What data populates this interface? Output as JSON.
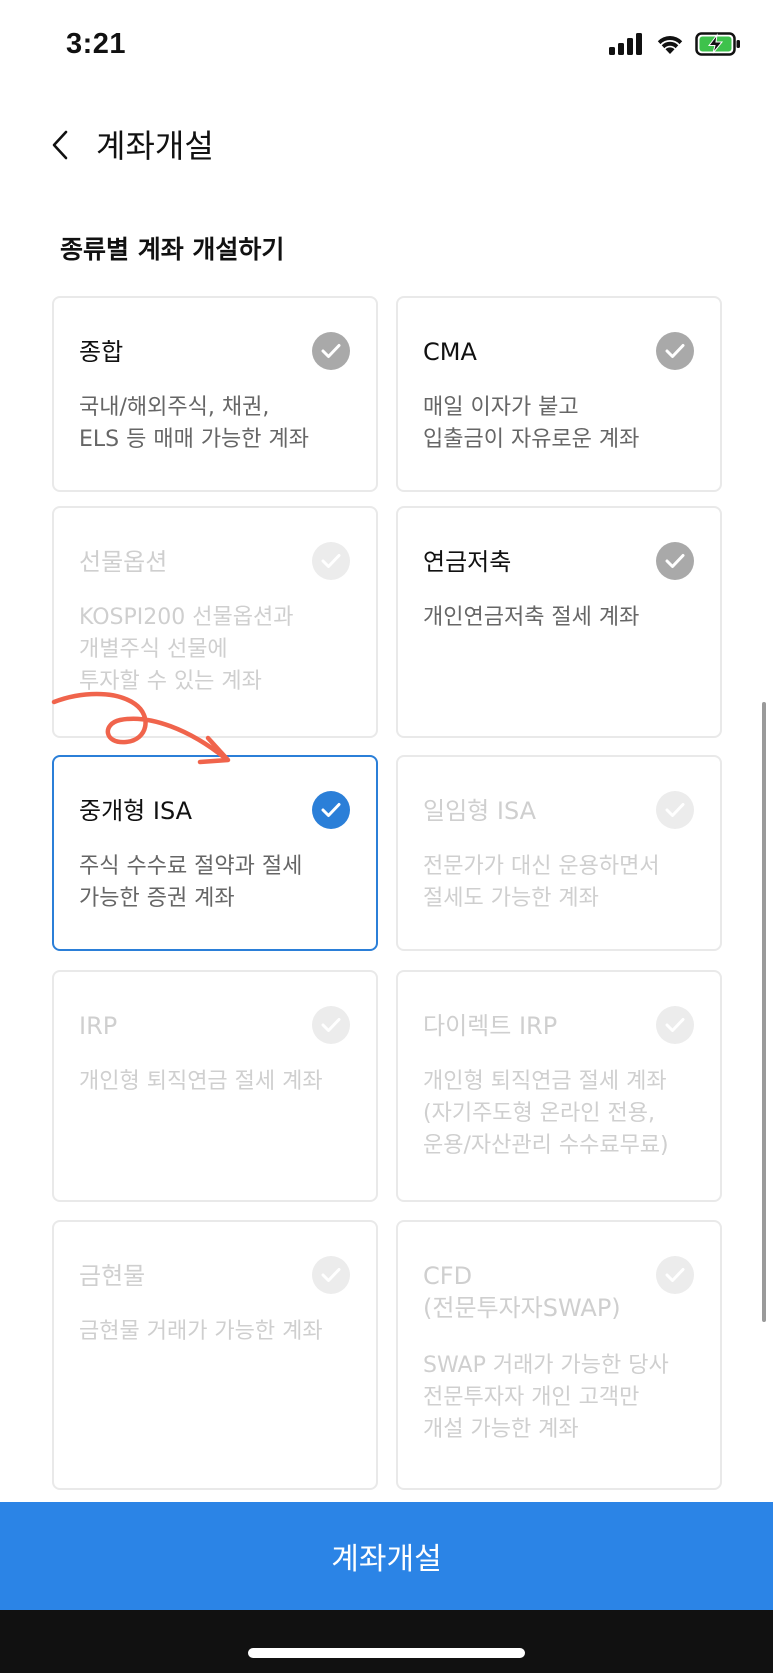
{
  "status_bar": {
    "time": "3:21",
    "icons": [
      "signal-icon",
      "wifi-icon",
      "battery-charging-icon"
    ]
  },
  "header": {
    "back_icon": "chevron-left-icon",
    "title": "계좌개설"
  },
  "section_title": "종류별 계좌 개설하기",
  "cards": [
    {
      "title": "종합",
      "desc": "국내/해외주식, 채권,\nELS 등 매매 가능한 계좌",
      "state": "enabled"
    },
    {
      "title": "CMA",
      "desc": "매일 이자가 붙고\n입출금이 자유로운 계좌",
      "state": "enabled"
    },
    {
      "title": "선물옵션",
      "desc": "KOSPI200 선물옵션과\n개별주식 선물에\n투자할 수 있는 계좌",
      "state": "disabled"
    },
    {
      "title": "연금저축",
      "desc": "개인연금저축 절세 계좌",
      "state": "enabled"
    },
    {
      "title": "중개형 ISA",
      "desc": "주식 수수료 절약과 절세\n가능한 증권 계좌",
      "state": "selected"
    },
    {
      "title": "일임형 ISA",
      "desc": "전문가가 대신 운용하면서\n절세도 가능한 계좌",
      "state": "disabled"
    },
    {
      "title": "IRP",
      "desc": "개인형 퇴직연금 절세 계좌",
      "state": "disabled"
    },
    {
      "title": "다이렉트 IRP",
      "desc": "개인형 퇴직연금 절세 계좌\n(자기주도형 온라인 전용,\n운용/자산관리 수수료무료)",
      "state": "disabled"
    },
    {
      "title": "금현물",
      "desc": "금현물 거래가 가능한 계좌",
      "state": "disabled"
    },
    {
      "title": "CFD\n(전문투자자SWAP)",
      "desc": "SWAP 거래가 가능한 당사\n전문투자자 개인 고객만\n개설 가능한 계좌",
      "state": "disabled"
    }
  ],
  "colors": {
    "accent": "#2b84e6",
    "selected_border": "#2b7fd8",
    "annotation": "#f0644c"
  },
  "bottom_button": {
    "label": "계좌개설"
  }
}
